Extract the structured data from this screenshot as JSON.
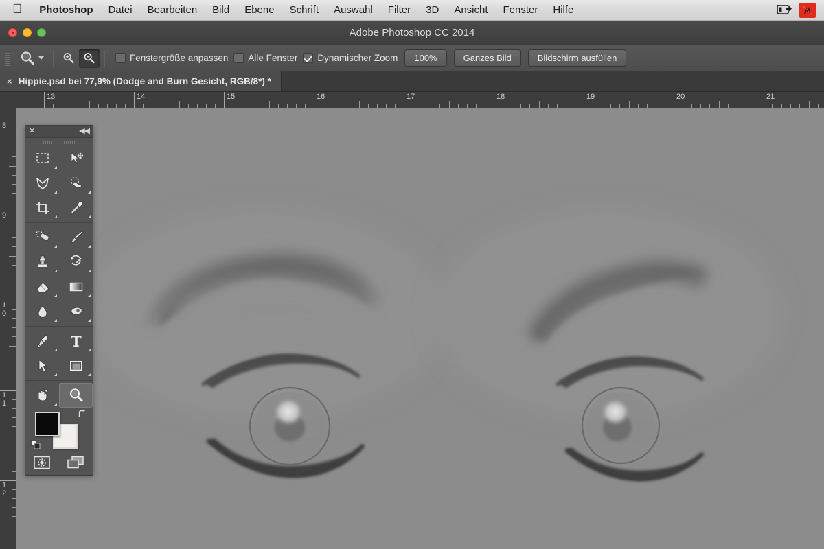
{
  "menubar": {
    "apple_icon": "apple-logo-icon",
    "items": [
      {
        "label": "Photoshop",
        "bold": true
      },
      {
        "label": "Datei",
        "bold": false
      },
      {
        "label": "Bearbeiten",
        "bold": false
      },
      {
        "label": "Bild",
        "bold": false
      },
      {
        "label": "Ebene",
        "bold": false
      },
      {
        "label": "Schrift",
        "bold": false
      },
      {
        "label": "Auswahl",
        "bold": false
      },
      {
        "label": "Filter",
        "bold": false
      },
      {
        "label": "3D",
        "bold": false
      },
      {
        "label": "Ansicht",
        "bold": false
      },
      {
        "label": "Fenster",
        "bold": false
      },
      {
        "label": "Hilfe",
        "bold": false
      }
    ],
    "status_icons": [
      {
        "name": "screen-share-icon"
      },
      {
        "name": "app-badge-icon",
        "color": "#e02b1d"
      }
    ]
  },
  "window": {
    "title": "Adobe Photoshop CC 2014",
    "controls": {
      "close": "close-button",
      "minimize": "minimize-button",
      "zoom": "zoom-button"
    }
  },
  "options_bar": {
    "tool_icon": "zoom-tool-icon",
    "tool_preset_arrow": "chevron-down-icon",
    "zoom_in_label": "zoom-in-icon",
    "zoom_out_label": "zoom-out-icon",
    "zoom_out_active": true,
    "checkboxes": [
      {
        "label": "Fenstergröße anpassen",
        "checked": false
      },
      {
        "label": "Alle Fenster",
        "checked": false
      },
      {
        "label": "Dynamischer Zoom",
        "checked": true
      }
    ],
    "buttons": [
      {
        "label": "100%"
      },
      {
        "label": "Ganzes Bild"
      },
      {
        "label": "Bildschirm ausfüllen"
      }
    ]
  },
  "document_tab": {
    "close_glyph": "×",
    "title": "Hippie.psd bei 77,9% (Dodge and Burn Gesicht, RGB/8*) *"
  },
  "rulers": {
    "unit_hint": "cm",
    "horizontal_labels": [
      "13",
      "14",
      "15",
      "16",
      "17",
      "18",
      "19",
      "20",
      "21"
    ],
    "vertical_labels": [
      "8",
      "9",
      "10",
      "11",
      "12"
    ]
  },
  "canvas": {
    "background_color": "#8c8c8c",
    "description": "Dodge-and-Burn grayscale face study showing two eyes with eyebrows"
  },
  "toolbox": {
    "close_glyph": "✕",
    "collapse_glyph": "◀◀",
    "tools": [
      {
        "name": "rectangular-marquee-tool",
        "has_flyout": true,
        "active": false
      },
      {
        "name": "move-tool",
        "has_flyout": false,
        "active": false
      },
      {
        "name": "lasso-tool",
        "has_flyout": true,
        "active": false
      },
      {
        "name": "quick-selection-tool",
        "has_flyout": true,
        "active": false
      },
      {
        "name": "crop-tool",
        "has_flyout": true,
        "active": false
      },
      {
        "name": "eyedropper-tool",
        "has_flyout": true,
        "active": false
      },
      {
        "name": "spot-healing-brush-tool",
        "has_flyout": true,
        "active": false
      },
      {
        "name": "brush-tool",
        "has_flyout": true,
        "active": false
      },
      {
        "name": "clone-stamp-tool",
        "has_flyout": true,
        "active": false
      },
      {
        "name": "history-brush-tool",
        "has_flyout": true,
        "active": false
      },
      {
        "name": "eraser-tool",
        "has_flyout": true,
        "active": false
      },
      {
        "name": "gradient-tool",
        "has_flyout": true,
        "active": false
      },
      {
        "name": "blur-tool",
        "has_flyout": true,
        "active": false
      },
      {
        "name": "dodge-tool",
        "has_flyout": true,
        "active": false
      },
      {
        "name": "pen-tool",
        "has_flyout": true,
        "active": false
      },
      {
        "name": "type-tool",
        "has_flyout": true,
        "active": false
      },
      {
        "name": "path-selection-tool",
        "has_flyout": true,
        "active": false
      },
      {
        "name": "rectangle-shape-tool",
        "has_flyout": true,
        "active": false
      },
      {
        "name": "hand-tool",
        "has_flyout": true,
        "active": false
      },
      {
        "name": "zoom-tool",
        "has_flyout": false,
        "active": true
      }
    ],
    "foreground_color": "#0a0a0a",
    "background_color": "#f2f0ec",
    "swap_icon": "swap-colors-icon",
    "default_icon": "default-colors-icon",
    "quick_mask_icon": "quick-mask-icon",
    "screen_mode_icon": "screen-mode-icon"
  }
}
